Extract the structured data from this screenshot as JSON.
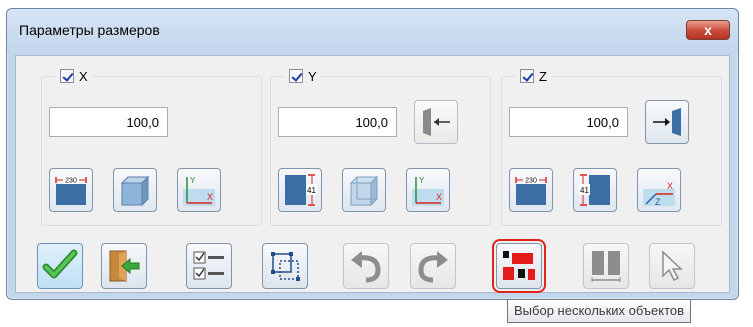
{
  "window": {
    "title": "Параметры размеров",
    "close_label": "x"
  },
  "groups": [
    {
      "axis": "X",
      "checked": true,
      "value": "100,0",
      "buttons": [
        {
          "icon": "width-dimension-icon",
          "label": "230"
        },
        {
          "icon": "cube-icon"
        },
        {
          "icon": "axes-xy-icon",
          "y_label": "Y",
          "x_label": "X"
        }
      ]
    },
    {
      "axis": "Y",
      "checked": true,
      "value": "100,0",
      "side_button": {
        "icon": "push-left-panel-icon"
      },
      "buttons": [
        {
          "icon": "height-dimension-icon",
          "label": "41"
        },
        {
          "icon": "cube-icon"
        },
        {
          "icon": "axes-xy-icon",
          "y_label": "Y",
          "x_label": "X"
        }
      ]
    },
    {
      "axis": "Z",
      "checked": true,
      "value": "100,0",
      "side_button": {
        "icon": "push-right-panel-icon"
      },
      "buttons": [
        {
          "icon": "width-dimension-icon",
          "label": "230"
        },
        {
          "icon": "height-dimension-icon",
          "label": "41"
        },
        {
          "icon": "axes-xz-icon",
          "x_label": "X",
          "z_label": "Z"
        }
      ]
    }
  ],
  "bottom_toolbar": [
    {
      "icon": "checkmark-icon",
      "state": "selected"
    },
    {
      "icon": "exit-door-icon",
      "state": "normal"
    },
    {
      "icon": "checklist-icon",
      "state": "normal"
    },
    {
      "icon": "select-frame-icon",
      "state": "normal"
    },
    {
      "icon": "undo-icon",
      "state": "disabled"
    },
    {
      "icon": "redo-icon",
      "state": "disabled"
    },
    {
      "icon": "multi-select-objects-icon",
      "state": "active"
    },
    {
      "icon": "split-panels-icon",
      "state": "disabled"
    },
    {
      "icon": "cursor-arrow-icon",
      "state": "disabled"
    }
  ],
  "tooltip": {
    "text": "Выбор нескольких объектов"
  },
  "colors": {
    "panel_blue": "#3a6ea5",
    "axis_red": "#d9231b",
    "check_green": "#3aa83a",
    "active_outline": "#e0241b"
  }
}
